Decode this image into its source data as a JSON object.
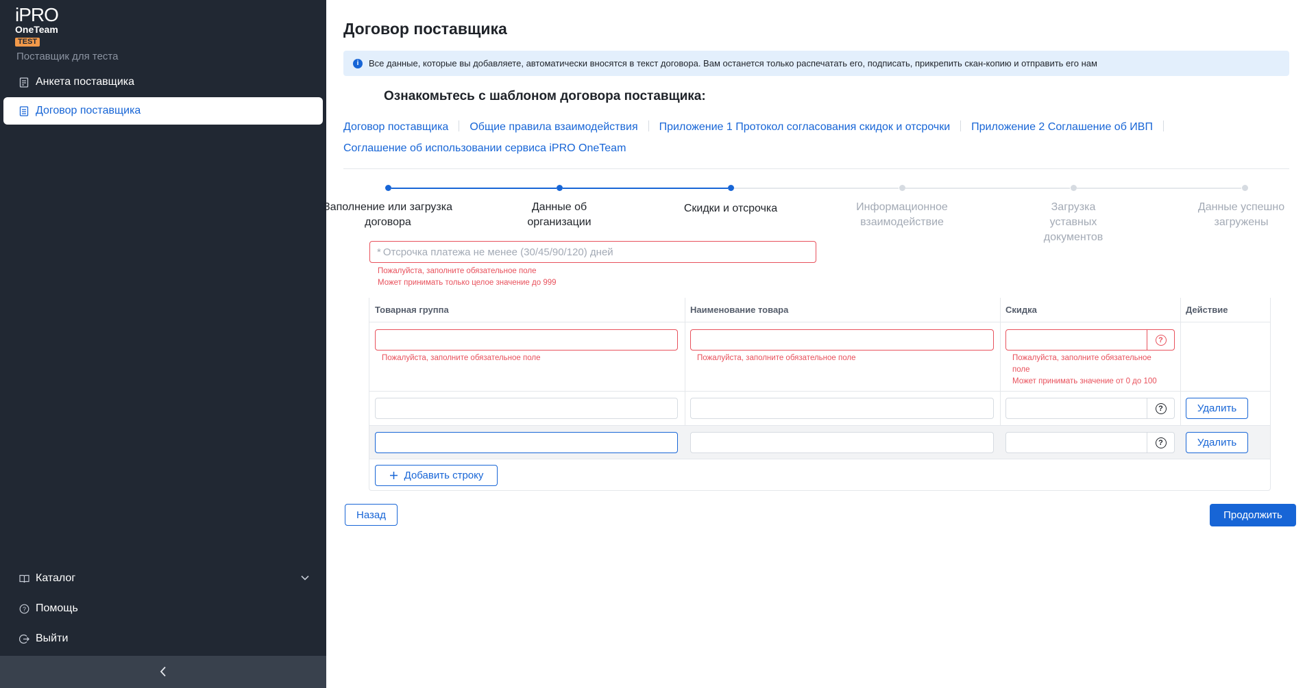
{
  "app": {
    "logo_line1": "iPRO",
    "logo_line2": "OneTeam",
    "logo_badge": "TEST",
    "supplier_name": "Поставщик для теста"
  },
  "sidebar": {
    "items": [
      {
        "label": "Анкета поставщика",
        "icon": "form-icon",
        "active": false
      },
      {
        "label": "Договор поставщика",
        "icon": "document-icon",
        "active": true
      }
    ],
    "bottom_items": [
      {
        "label": "Каталог",
        "icon": "catalog-icon"
      },
      {
        "label": "Помощь",
        "icon": "help-icon"
      },
      {
        "label": "Выйти",
        "icon": "logout-icon"
      }
    ],
    "collapse_icon": "chevron-left-icon"
  },
  "page": {
    "title": "Договор поставщика",
    "info": "Все данные, которые вы добавляете, автоматически вносятся в текст договора. Вам останется только распечатать его, подписать, прикрепить скан-копию и отправить его нам",
    "template_heading": "Ознакомьтесь с шаблоном договора поставщика:",
    "links": [
      "Договор поставщика",
      "Общие правила взаимодействия",
      "Приложение 1 Протокол согласования скидок и отсрочки",
      "Приложение 2 Соглашение об ИВП",
      "Соглашение об использовании сервиса iPRO OneTeam"
    ]
  },
  "stepper": {
    "steps": [
      {
        "label": "Заполнение или загрузка договора",
        "state": "done"
      },
      {
        "label": "Данные об организации",
        "state": "done"
      },
      {
        "label": "Скидки и отсрочка",
        "state": "current"
      },
      {
        "label": "Информационное взаимодействие",
        "state": "todo"
      },
      {
        "label": "Загрузка уставных документов",
        "state": "todo"
      },
      {
        "label": "Данные успешно загружены",
        "state": "todo"
      }
    ]
  },
  "form": {
    "deferral_placeholder": "Отсрочка платежа не менее (30/45/90/120) дней",
    "deferral_required_mark": "*",
    "deferral_error_1": "Пожалуйста, заполните обязательное поле",
    "deferral_error_2": "Может принимать только целое значение до 999"
  },
  "table": {
    "headers": [
      "Товарная группа",
      "Наименование товара",
      "Скидка",
      "Действие"
    ],
    "row_errors": {
      "required": "Пожалуйста, заполните обязательное поле",
      "required_wrap_1": "Пожалуйста, заполните обязательное",
      "required_wrap_2": "поле",
      "discount_range": "Может принимать значение от 0 до 100"
    },
    "delete_label": "Удалить",
    "add_row_label": "Добавить строку",
    "help_glyph": "?"
  },
  "actions": {
    "back": "Назад",
    "next": "Продолжить"
  },
  "colors": {
    "sidebar": "#212833",
    "accent": "#1765d6",
    "error": "#e8505b",
    "info_bg": "#e3effc"
  }
}
